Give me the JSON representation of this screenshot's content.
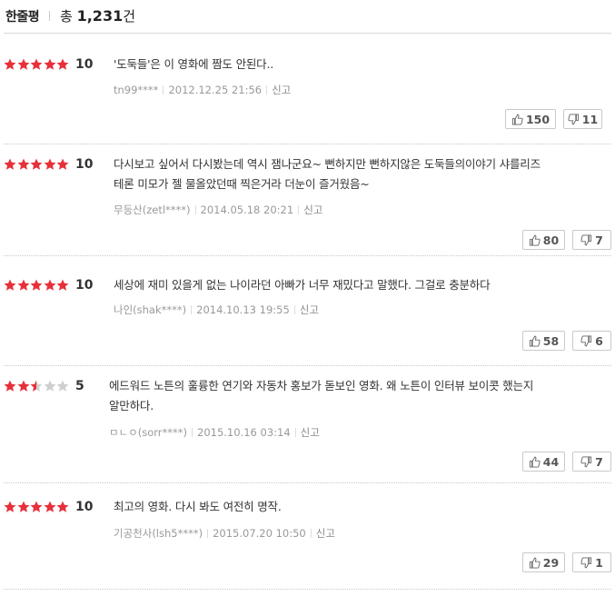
{
  "header": {
    "title": "한줄평",
    "total_prefix": "총",
    "total_count": "1,231",
    "total_suffix": "건"
  },
  "colors": {
    "star_on": "#e8303a",
    "star_off": "#cfcfcf"
  },
  "report_label": "신고",
  "reviews": [
    {
      "rating": 5,
      "score": "10",
      "lines": [
        "'도둑들'은 이 영화에 짬도 안된다.."
      ],
      "author": "tn99****",
      "date": "2012.12.25 21:56",
      "likes": "150",
      "dislikes": "11"
    },
    {
      "rating": 5,
      "score": "10",
      "lines": [
        "다시보고 싶어서 다시봤는데 역시 잼나군요~ 뻔하지만 뻔하지않은 도둑들의이야기 샤를리즈",
        "테론 미모가 젤 물올았던때 찍은거라 더눈이 즐거웠음~"
      ],
      "author": "무등산(zetl****)",
      "date": "2014.05.18 20:21",
      "likes": "80",
      "dislikes": "7"
    },
    {
      "rating": 5,
      "score": "10",
      "lines": [
        "세상에 재미 있을게 없는 나이라던 아빠가 너무 재밌다고 말했다. 그걸로 충분하다"
      ],
      "author": "나인(shak****)",
      "date": "2014.10.13 19:55",
      "likes": "58",
      "dislikes": "6"
    },
    {
      "rating": 2.5,
      "score": "5",
      "lines": [
        "에드워드 노튼의 훌륭한 연기와 자동차 홍보가 돋보인 영화. 왜 노튼이 인터뷰 보이콧 했는지",
        "알만하다."
      ],
      "author": "ㅁㄴㅇ(sorr****)",
      "date": "2015.10.16 03:14",
      "likes": "44",
      "dislikes": "7"
    },
    {
      "rating": 5,
      "score": "10",
      "lines": [
        "최고의 영화. 다시 봐도 여전히 명작."
      ],
      "author": "기공천사(lsh5****)",
      "date": "2015.07.20 10:50",
      "likes": "29",
      "dislikes": "1"
    }
  ]
}
